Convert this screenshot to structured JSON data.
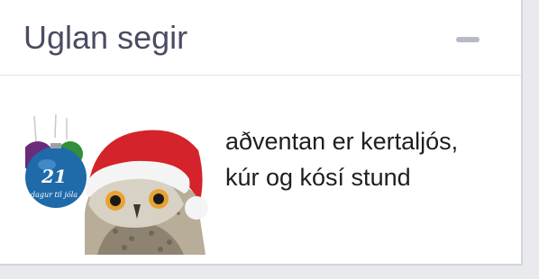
{
  "widget": {
    "title": "Uglan segir",
    "collapse_icon": "minus-icon",
    "image": {
      "icon": "christmas-owl-illustration",
      "ornament_number": "21",
      "ornament_caption": "dagur til jóla"
    },
    "message_lines": [
      "aðventan er kertaljós,",
      "kúr og kósí stund"
    ]
  },
  "colors": {
    "title": "#4a4d62",
    "text": "#1e1e22",
    "collapse": "#b7bac4",
    "hat_red": "#d4232b",
    "ornament_blue": "#1f6aa8"
  }
}
